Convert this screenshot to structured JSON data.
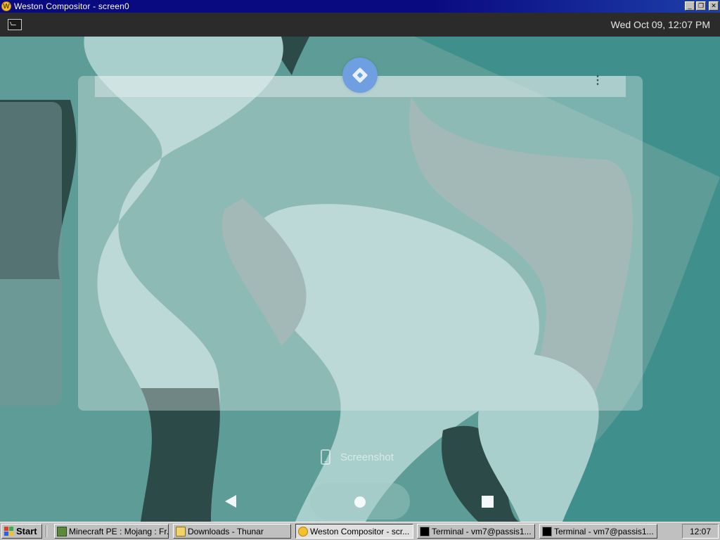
{
  "window": {
    "title": "Weston Compositor - screen0",
    "icon": "weston-app-icon",
    "buttons": {
      "minimize": "_",
      "restore": "❐",
      "close": "✕"
    }
  },
  "weston_panel": {
    "launcher_icon": "terminal-icon",
    "clock": "Wed Oct 09, 12:07 PM"
  },
  "android": {
    "recent_app_icon": "app-diamond-icon",
    "card_menu_icon": "⋮",
    "screenshot_label": "Screenshot",
    "nav": {
      "back": "back-icon",
      "home": "home-icon",
      "recents": "recents-icon"
    }
  },
  "taskbar": {
    "start_label": "Start",
    "buttons": [
      {
        "label": "Minecraft PE : Mojang : Fr...",
        "icon": "minecraft-icon",
        "active": false
      },
      {
        "label": "Downloads - Thunar",
        "icon": "folder-icon",
        "active": false
      },
      {
        "label": "Weston Compositor - scr...",
        "icon": "weston-icon",
        "active": true
      },
      {
        "label": "Terminal - vm7@passis1...",
        "icon": "terminal-icon",
        "active": false
      },
      {
        "label": "Terminal - vm7@passis1...",
        "icon": "terminal-icon",
        "active": false
      }
    ],
    "tray_clock": "12:07"
  },
  "colors": {
    "titlebar": "#0a0a80",
    "weston_panel": "#2b2b2b",
    "wallpaper_teal": "#5e9d97",
    "wallpaper_dark": "#2c4a47",
    "wallpaper_light": "#a9cfcc",
    "taskbar": "#c0c0c0"
  }
}
